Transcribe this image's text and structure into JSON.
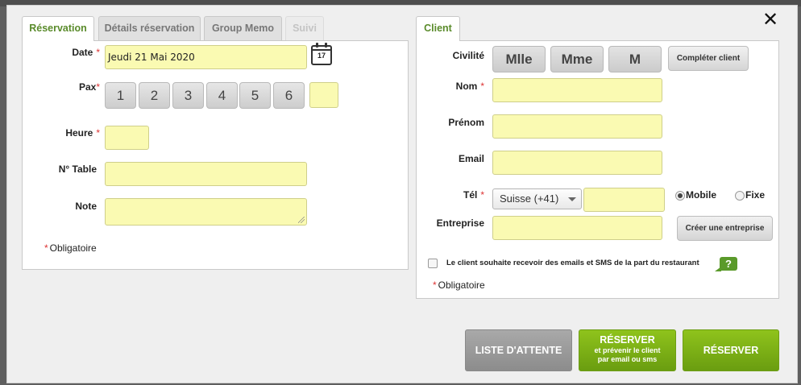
{
  "tabs_left": [
    {
      "label": "Réservation",
      "state": "active"
    },
    {
      "label": "Détails réservation",
      "state": "normal"
    },
    {
      "label": "Group Memo",
      "state": "normal"
    },
    {
      "label": "Suivi",
      "state": "disabled"
    }
  ],
  "tabs_right": [
    {
      "label": "Client",
      "state": "active"
    }
  ],
  "close_icon": "close-icon",
  "reservation": {
    "date_label": "Date",
    "date_value": "Jeudi 21 Mai 2020",
    "calendar_icon": "calendar-icon",
    "calendar_day": "17",
    "pax_label": "Pax",
    "pax_options": [
      "1",
      "2",
      "3",
      "4",
      "5",
      "6"
    ],
    "pax_custom_value": "",
    "heure_label": "Heure",
    "heure_value": "",
    "table_label": "N° Table",
    "table_value": "",
    "note_label": "Note",
    "note_value": "",
    "required_mark": "*",
    "obligatoire": "Obligatoire"
  },
  "client": {
    "civilite_label": "Civilité",
    "civilite_options": [
      "Mlle",
      "Mme",
      "M"
    ],
    "completer_label": "Compléter client",
    "nom_label": "Nom",
    "nom_value": "",
    "prenom_label": "Prénom",
    "prenom_value": "",
    "email_label": "Email",
    "email_value": "",
    "tel_label": "Tél",
    "country_selected": "Suisse (+41)",
    "tel_value": "",
    "phone_type_options": [
      "Mobile",
      "Fixe"
    ],
    "phone_type_selected": "Mobile",
    "entreprise_label": "Entreprise",
    "entreprise_value": "",
    "creer_entreprise_label": "Créer une entreprise",
    "consent_text": "Le client souhaite recevoir des emails et SMS de la part du restaurant",
    "help_glyph": "?",
    "obligatoire": "Obligatoire"
  },
  "actions": {
    "liste_attente": "LISTE D'ATTENTE",
    "reserver_notify_title": "RÉSERVER",
    "reserver_notify_sub1": "et prévenir le client",
    "reserver_notify_sub2": "par email ou sms",
    "reserver": "RÉSERVER"
  },
  "colors": {
    "field_bg": "#fafab2",
    "accent_green": "#7db319",
    "tab_active_text": "#5a8b2b",
    "required_red": "#dd3333"
  }
}
